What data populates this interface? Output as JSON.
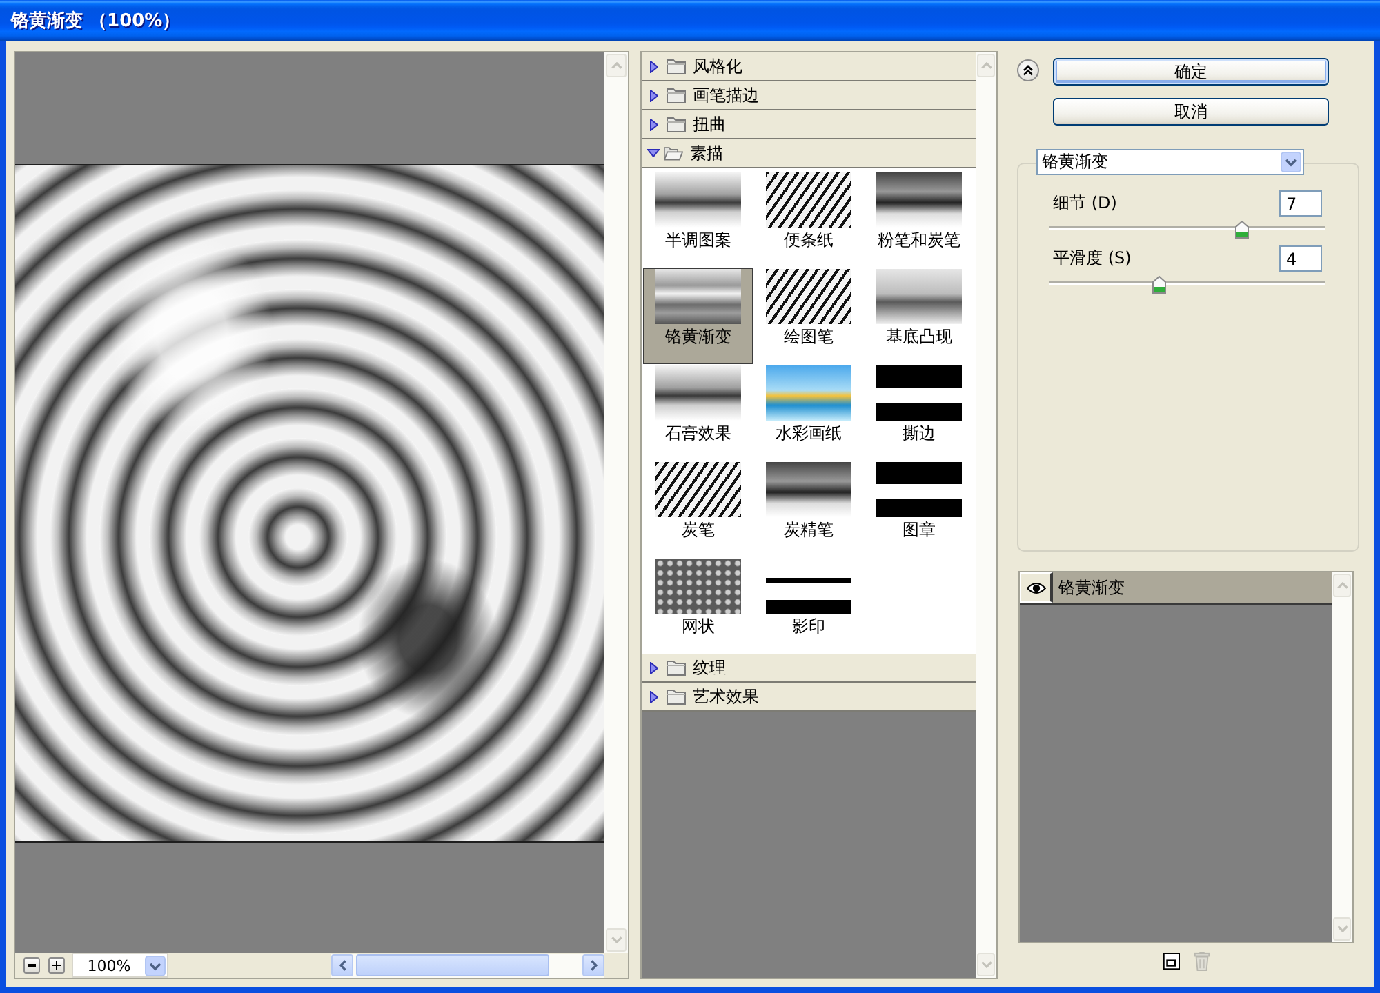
{
  "window": {
    "title": "铬黄渐变 （100%）"
  },
  "preview": {
    "zoom": "100%"
  },
  "filter_gallery": {
    "categories": [
      {
        "name": "风格化",
        "expanded": false
      },
      {
        "name": "画笔描边",
        "expanded": false
      },
      {
        "name": "扭曲",
        "expanded": false
      },
      {
        "name": "素描",
        "expanded": true,
        "filters": [
          {
            "name": "半调图案",
            "selected": false
          },
          {
            "name": "便条纸",
            "selected": false
          },
          {
            "name": "粉笔和炭笔",
            "selected": false
          },
          {
            "name": "铬黄渐变",
            "selected": true
          },
          {
            "name": "绘图笔",
            "selected": false
          },
          {
            "name": "基底凸现",
            "selected": false
          },
          {
            "name": "石膏效果",
            "selected": false
          },
          {
            "name": "水彩画纸",
            "selected": false
          },
          {
            "name": "撕边",
            "selected": false
          },
          {
            "name": "炭笔",
            "selected": false
          },
          {
            "name": "炭精笔",
            "selected": false
          },
          {
            "name": "图章",
            "selected": false
          },
          {
            "name": "网状",
            "selected": false
          },
          {
            "name": "影印",
            "selected": false
          }
        ]
      },
      {
        "name": "纹理",
        "expanded": false
      },
      {
        "name": "艺术效果",
        "expanded": false
      }
    ]
  },
  "buttons": [
    {
      "label": "确定",
      "default": true
    },
    {
      "label": "取消",
      "default": false
    }
  ],
  "settings": {
    "filter": "铬黄渐变",
    "params": [
      {
        "label": "细节 (D)",
        "value": "7",
        "level": 0.7
      },
      {
        "label": "平滑度 (S)",
        "value": "4",
        "level": 0.4
      }
    ]
  },
  "layers": [
    {
      "name": "铬黄渐变",
      "selected": true,
      "visible": true
    }
  ],
  "layer_buttons": [
    {
      "kind": "new",
      "disabled": false
    },
    {
      "kind": "delete",
      "disabled": true
    }
  ]
}
